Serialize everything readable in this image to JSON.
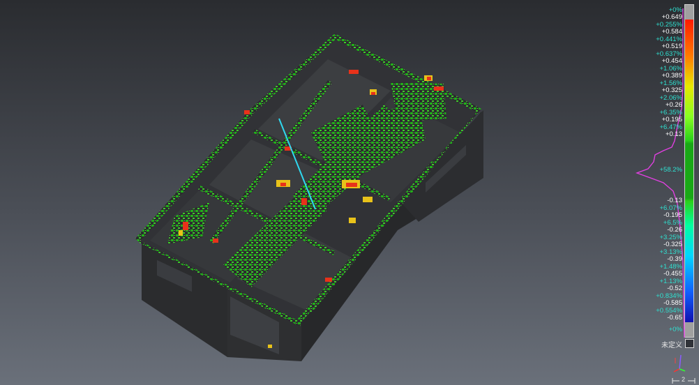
{
  "viewer": {
    "colors": {
      "background_top": "#2a2c30",
      "background_bottom": "#6a707a",
      "model_wall": "#2b2c2e",
      "deviation_green": "#22b51a",
      "deviation_red": "#e8321a",
      "deviation_yellow": "#e8c21a",
      "histogram_line": "#e040e0",
      "percent_text": "#2fe0d0"
    }
  },
  "color_scale": {
    "gradient": [
      "#ff1a00",
      "#ff9a00",
      "#e8e800",
      "#88ff00",
      "#21b51a",
      "#21b51a",
      "#00d8ff",
      "#0060ff",
      "#1010c0"
    ],
    "labels": [
      {
        "text": "+0%",
        "kind": "pct",
        "pos": 0.018
      },
      {
        "text": "+0.649",
        "kind": "val",
        "pos": 0.04
      },
      {
        "text": "+0.255%",
        "kind": "pct",
        "pos": 0.062
      },
      {
        "text": "+0.584",
        "kind": "val",
        "pos": 0.084
      },
      {
        "text": "+0.441%",
        "kind": "pct",
        "pos": 0.106
      },
      {
        "text": "+0.519",
        "kind": "val",
        "pos": 0.128
      },
      {
        "text": "+0.637%",
        "kind": "pct",
        "pos": 0.15
      },
      {
        "text": "+0.454",
        "kind": "val",
        "pos": 0.172
      },
      {
        "text": "+1.06%",
        "kind": "pct",
        "pos": 0.194
      },
      {
        "text": "+0.389",
        "kind": "val",
        "pos": 0.216
      },
      {
        "text": "+1.56%",
        "kind": "pct",
        "pos": 0.238
      },
      {
        "text": "+0.325",
        "kind": "val",
        "pos": 0.26
      },
      {
        "text": "+2.06%",
        "kind": "pct",
        "pos": 0.282
      },
      {
        "text": "+0.26",
        "kind": "val",
        "pos": 0.304
      },
      {
        "text": "+6.35%",
        "kind": "pct",
        "pos": 0.326
      },
      {
        "text": "+0.195",
        "kind": "val",
        "pos": 0.348
      },
      {
        "text": "+6.47%",
        "kind": "pct",
        "pos": 0.37
      },
      {
        "text": "+0.13",
        "kind": "val",
        "pos": 0.392
      },
      {
        "text": "+58.2%",
        "kind": "pct",
        "pos": 0.498
      },
      {
        "text": "-0.13",
        "kind": "val",
        "pos": 0.59
      },
      {
        "text": "+6.07%",
        "kind": "pct",
        "pos": 0.612
      },
      {
        "text": "-0.195",
        "kind": "val",
        "pos": 0.634
      },
      {
        "text": "+6.5%",
        "kind": "pct",
        "pos": 0.656
      },
      {
        "text": "-0.26",
        "kind": "val",
        "pos": 0.678
      },
      {
        "text": "+3.25%",
        "kind": "pct",
        "pos": 0.7
      },
      {
        "text": "-0.325",
        "kind": "val",
        "pos": 0.722
      },
      {
        "text": "+3.13%",
        "kind": "pct",
        "pos": 0.744
      },
      {
        "text": "-0.39",
        "kind": "val",
        "pos": 0.766
      },
      {
        "text": "+1.48%",
        "kind": "pct",
        "pos": 0.788
      },
      {
        "text": "-0.455",
        "kind": "val",
        "pos": 0.81
      },
      {
        "text": "+1.13%",
        "kind": "pct",
        "pos": 0.832
      },
      {
        "text": "-0.52",
        "kind": "val",
        "pos": 0.854
      },
      {
        "text": "+0.834%",
        "kind": "pct",
        "pos": 0.876
      },
      {
        "text": "-0.585",
        "kind": "val",
        "pos": 0.898
      },
      {
        "text": "+0.554%",
        "kind": "pct",
        "pos": 0.92
      },
      {
        "text": "-0.65",
        "kind": "val",
        "pos": 0.942
      },
      {
        "text": "+0%",
        "kind": "pct",
        "pos": 0.978
      }
    ],
    "undefined_label": "未定义",
    "triad_icon": "xyz-axis-triad-icon",
    "scale_bar_label": "2"
  }
}
